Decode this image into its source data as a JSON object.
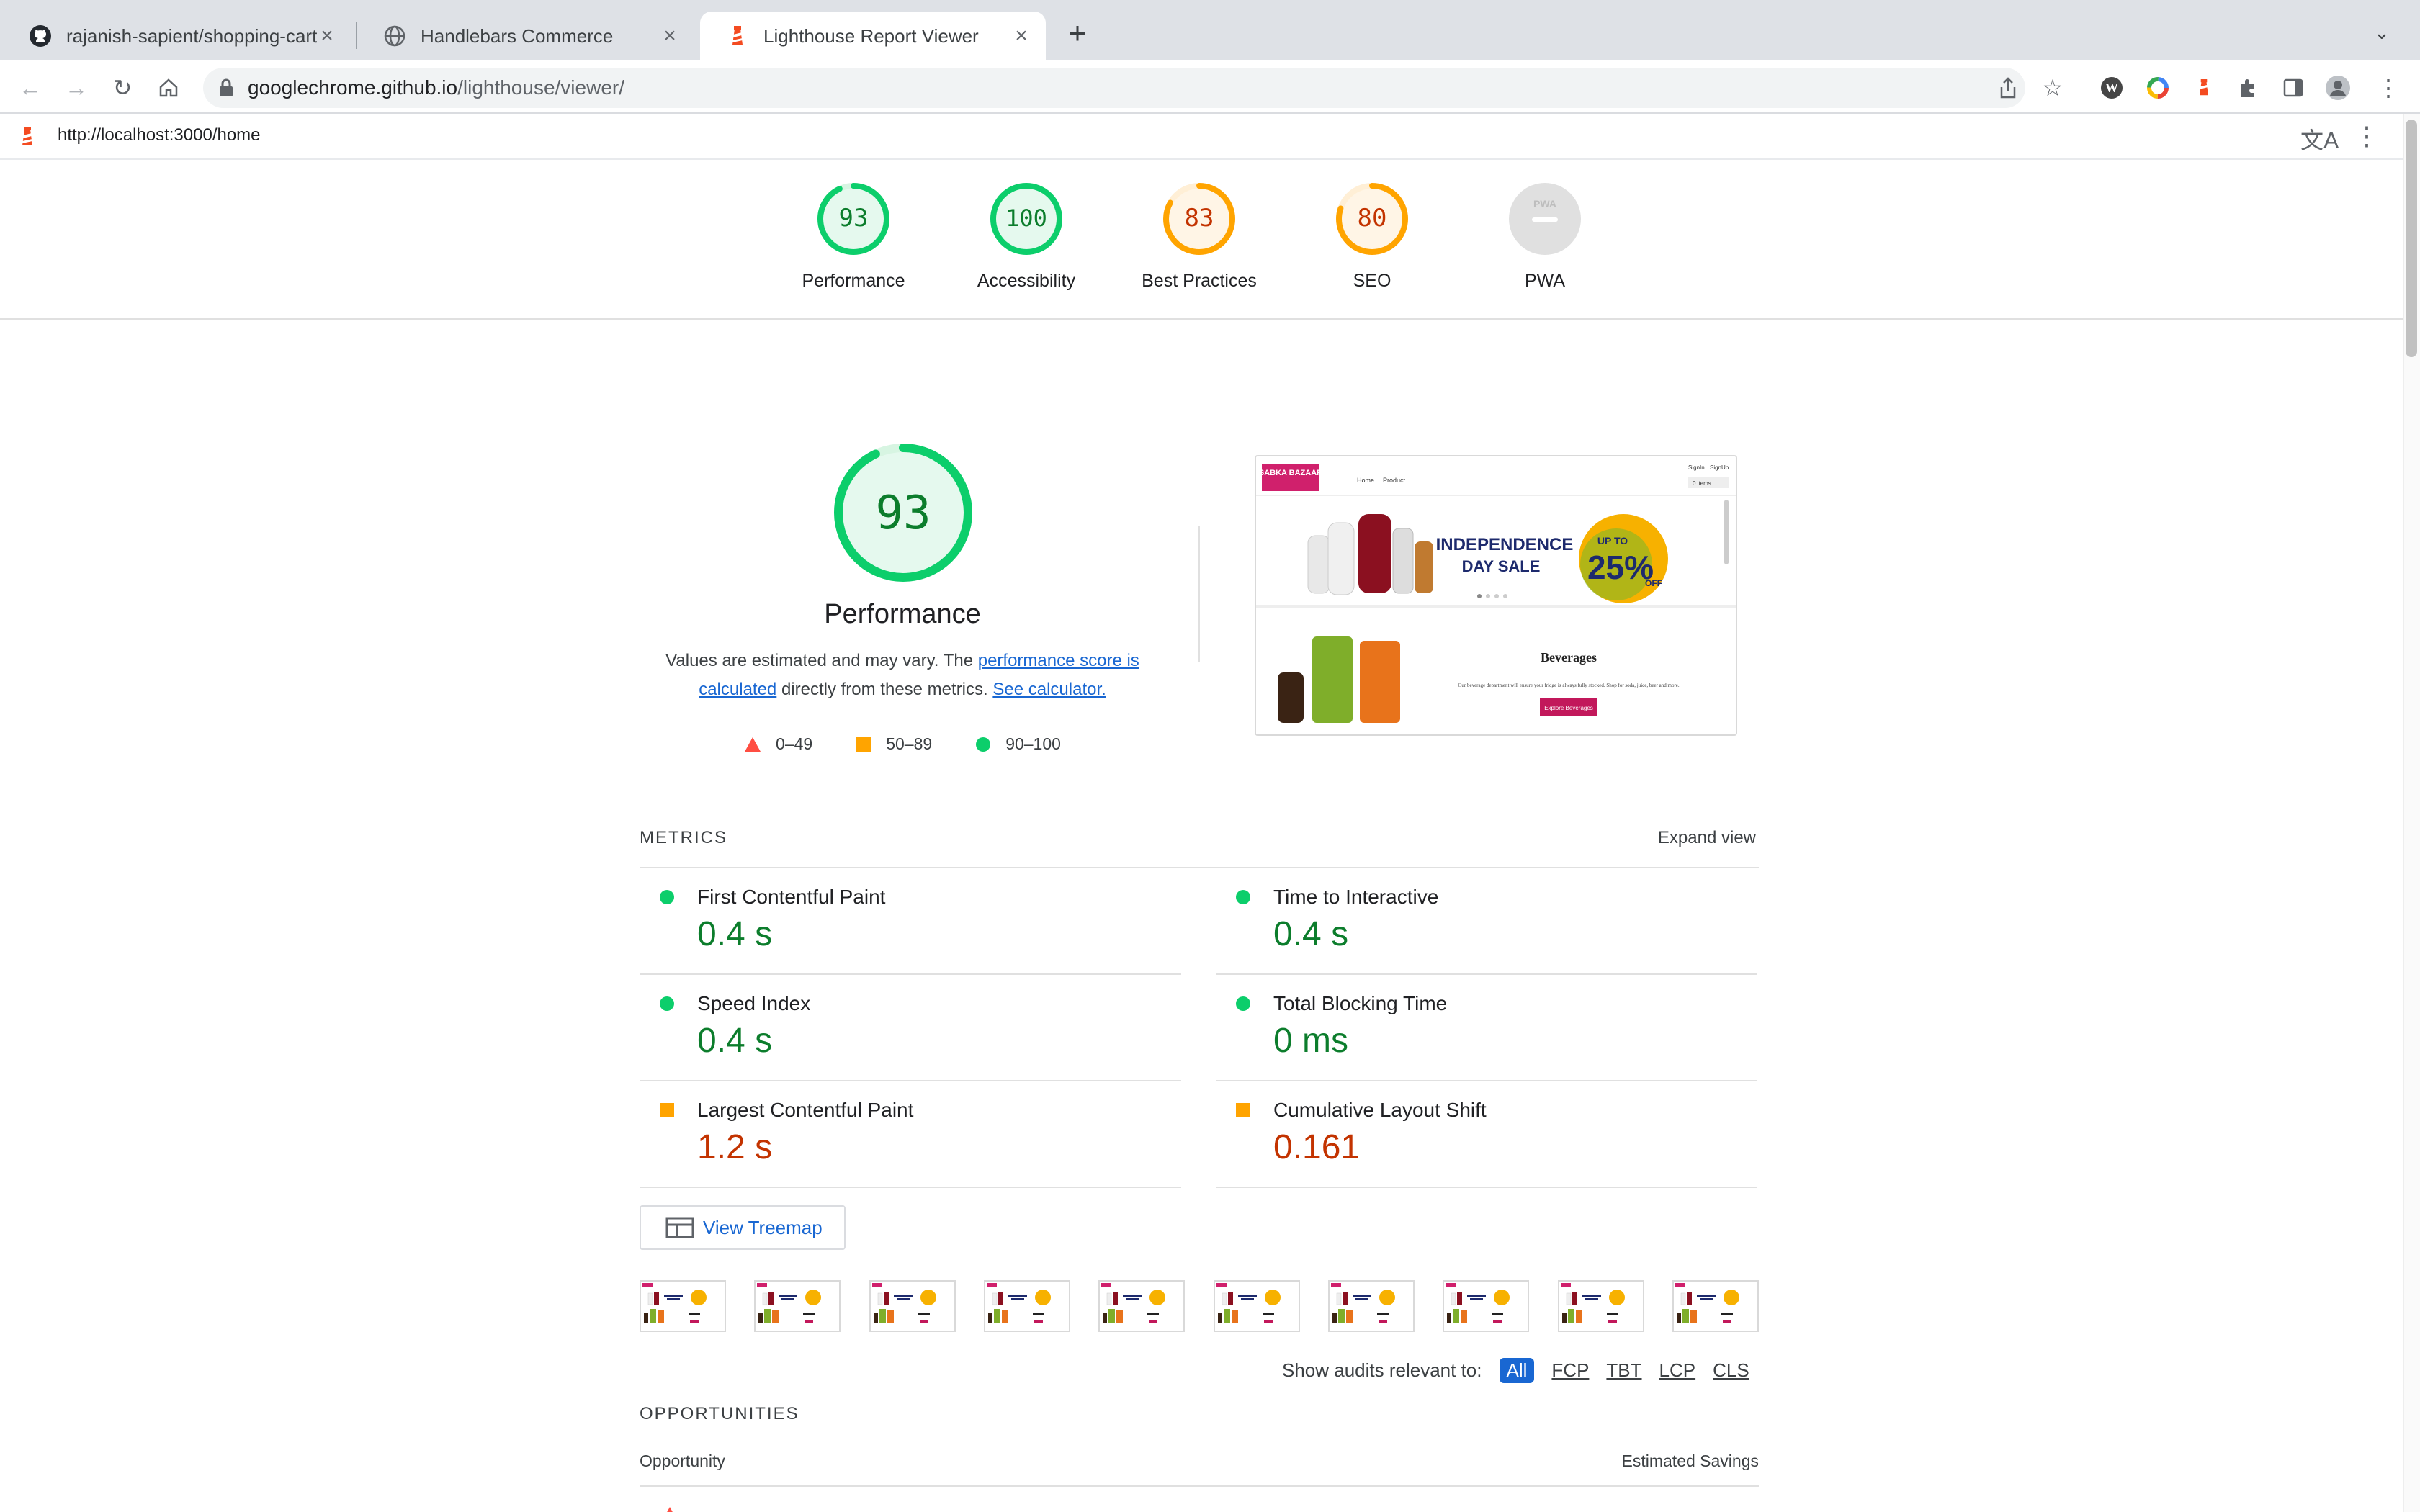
{
  "browser": {
    "tabs": [
      {
        "title": "rajanish-sapient/shopping-cart",
        "icon": "github-icon"
      },
      {
        "title": "Handlebars Commerce",
        "icon": "globe-icon"
      },
      {
        "title": "Lighthouse Report Viewer",
        "icon": "lighthouse-icon",
        "active": true
      }
    ],
    "new_tab": "+",
    "url_host": "googlechrome.github.io",
    "url_path": "/lighthouse/viewer/"
  },
  "report": {
    "url": "http://localhost:3000/home",
    "categories": [
      {
        "label": "Performance",
        "score": "93",
        "color": "#0cce6b"
      },
      {
        "label": "Accessibility",
        "score": "100",
        "color": "#0cce6b"
      },
      {
        "label": "Best Practices",
        "score": "83",
        "color": "#ffa400"
      },
      {
        "label": "SEO",
        "score": "80",
        "color": "#ffa400"
      },
      {
        "label": "PWA",
        "score": "",
        "color": "#9e9e9e"
      }
    ],
    "performance": {
      "score": "93",
      "title": "Performance",
      "desc_1": "Values are estimated and may vary. The ",
      "desc_link_1": "performance score is calculated",
      "desc_2": " directly from these metrics. ",
      "desc_link_2": "See calculator.",
      "legend": [
        "0–49",
        "50–89",
        "90–100"
      ]
    },
    "screenshot": {
      "brand": "SABKA BAZAAR",
      "nav": [
        "Home",
        "Product"
      ],
      "auth": [
        "SignIn",
        "SignUp"
      ],
      "cart": "0 items",
      "banner": "INDEPENDENCE DAY SALE",
      "badge_top": "UP TO",
      "badge_pct": "25%",
      "badge_off": "OFF",
      "section": "Beverages",
      "section_desc": "Our beverage department will ensure your fridge is always fully stocked. Shop for soda, juice, beer and more.",
      "section_button": "Explore Beverages"
    },
    "metrics": {
      "title": "METRICS",
      "expand": "Expand view",
      "items": [
        {
          "name": "First Contentful Paint",
          "value": "0.4 s",
          "rating": "pass"
        },
        {
          "name": "Time to Interactive",
          "value": "0.4 s",
          "rating": "pass"
        },
        {
          "name": "Speed Index",
          "value": "0.4 s",
          "rating": "pass"
        },
        {
          "name": "Total Blocking Time",
          "value": "0 ms",
          "rating": "pass"
        },
        {
          "name": "Largest Contentful Paint",
          "value": "1.2 s",
          "rating": "average"
        },
        {
          "name": "Cumulative Layout Shift",
          "value": "0.161",
          "rating": "average"
        }
      ]
    },
    "treemap_label": "View Treemap",
    "audit_filter": {
      "label": "Show audits relevant to:",
      "chips": [
        "All",
        "FCP",
        "TBT",
        "LCP",
        "CLS"
      ]
    },
    "opportunities": {
      "title": "OPPORTUNITIES",
      "col_left": "Opportunity",
      "col_right": "Estimated Savings"
    },
    "colors": {
      "pass": "#0cce6b",
      "average": "#ffa400",
      "fail": "#ff4e42",
      "link": "#1967d2"
    }
  }
}
